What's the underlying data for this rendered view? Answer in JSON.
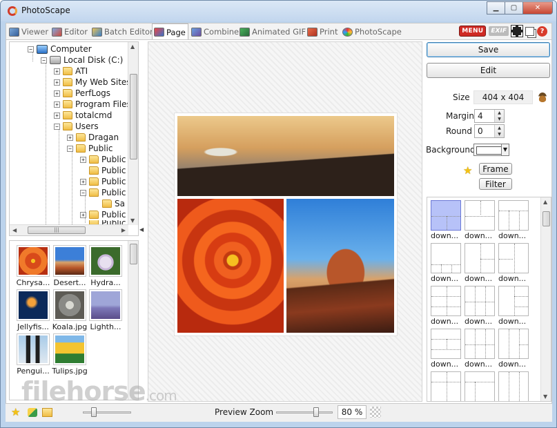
{
  "window": {
    "title": "PhotoScape"
  },
  "tabs": [
    {
      "label": "Viewer",
      "icon": "viewer-icon"
    },
    {
      "label": "Editor",
      "icon": "editor-icon"
    },
    {
      "label": "Batch Editor",
      "icon": "batch-editor-icon"
    },
    {
      "label": "Page",
      "icon": "page-icon",
      "active": true
    },
    {
      "label": "Combine",
      "icon": "combine-icon"
    },
    {
      "label": "Animated GIF",
      "icon": "animated-gif-icon"
    },
    {
      "label": "Print",
      "icon": "print-icon"
    },
    {
      "label": "PhotoScape",
      "icon": "photoscape-icon"
    }
  ],
  "toolbar_right": {
    "menu_label": "MENU",
    "exif_label": "EXIF"
  },
  "tree": {
    "items": [
      {
        "label": "Computer",
        "icon": "computer-icon"
      },
      {
        "label": "Local Disk (C:)",
        "icon": "disk-icon"
      },
      {
        "label": "ATI",
        "icon": "folder-icon"
      },
      {
        "label": "My Web Sites",
        "icon": "folder-icon"
      },
      {
        "label": "PerfLogs",
        "icon": "folder-icon"
      },
      {
        "label": "Program Files",
        "icon": "folder-icon"
      },
      {
        "label": "totalcmd",
        "icon": "folder-icon"
      },
      {
        "label": "Users",
        "icon": "folder-icon"
      },
      {
        "label": "Dragan",
        "icon": "folder-icon"
      },
      {
        "label": "Public",
        "icon": "folder-icon"
      },
      {
        "label": "Public",
        "icon": "folder-icon"
      },
      {
        "label": "Public",
        "icon": "folder-icon"
      },
      {
        "label": "Public",
        "icon": "folder-icon"
      },
      {
        "label": "Public",
        "icon": "folder-icon"
      },
      {
        "label": "Sa",
        "icon": "folder-icon"
      },
      {
        "label": "Public",
        "icon": "folder-icon"
      },
      {
        "label": "Public",
        "icon": "folder-icon"
      }
    ]
  },
  "thumbnails": [
    {
      "label": "Chrysa...",
      "colors": [
        "#d84a1a",
        "#f07a2a"
      ]
    },
    {
      "label": "Desert...",
      "colors": [
        "#3c7fd8",
        "#b8562a"
      ]
    },
    {
      "label": "Hydra...",
      "colors": [
        "#3b6b2c",
        "#e8e0f0"
      ]
    },
    {
      "label": "Jellyfis...",
      "colors": [
        "#0c2a5a",
        "#f5a23a"
      ]
    },
    {
      "label": "Koala.jpg",
      "colors": [
        "#8a8a86",
        "#d9d9d2"
      ]
    },
    {
      "label": "Lighth...",
      "colors": [
        "#9fa6d8",
        "#5a4d8a"
      ]
    },
    {
      "label": "Pengui...",
      "colors": [
        "#a8cbe8",
        "#1f1f1f"
      ]
    },
    {
      "label": "Tulips.jpg",
      "colors": [
        "#f4c430",
        "#2f7d32"
      ]
    }
  ],
  "right_panel": {
    "save_label": "Save",
    "edit_label": "Edit",
    "size_label": "Size",
    "size_value": "404 x 404",
    "margin_label": "Margin",
    "margin_value": "4",
    "round_label": "Round",
    "round_value": "0",
    "background_label": "Background",
    "background_color": "#ffffff",
    "frame_label": "Frame",
    "filter_label": "Filter"
  },
  "layouts": [
    {
      "label": "down...",
      "selected": true
    },
    {
      "label": "down..."
    },
    {
      "label": "down..."
    },
    {
      "label": "down..."
    },
    {
      "label": "down..."
    },
    {
      "label": "down..."
    },
    {
      "label": "down..."
    },
    {
      "label": "down..."
    },
    {
      "label": "down..."
    },
    {
      "label": "down..."
    },
    {
      "label": "down..."
    },
    {
      "label": "down..."
    }
  ],
  "status": {
    "zoom_label": "Preview Zoom",
    "zoom_value": "80 %"
  },
  "watermark": {
    "text": "filehorse",
    "suffix": ".com"
  },
  "colors": {
    "frame_bg": "#bcd3ec",
    "accent_red": "#cf2a24",
    "selected_layout": "#b7c2f8"
  }
}
